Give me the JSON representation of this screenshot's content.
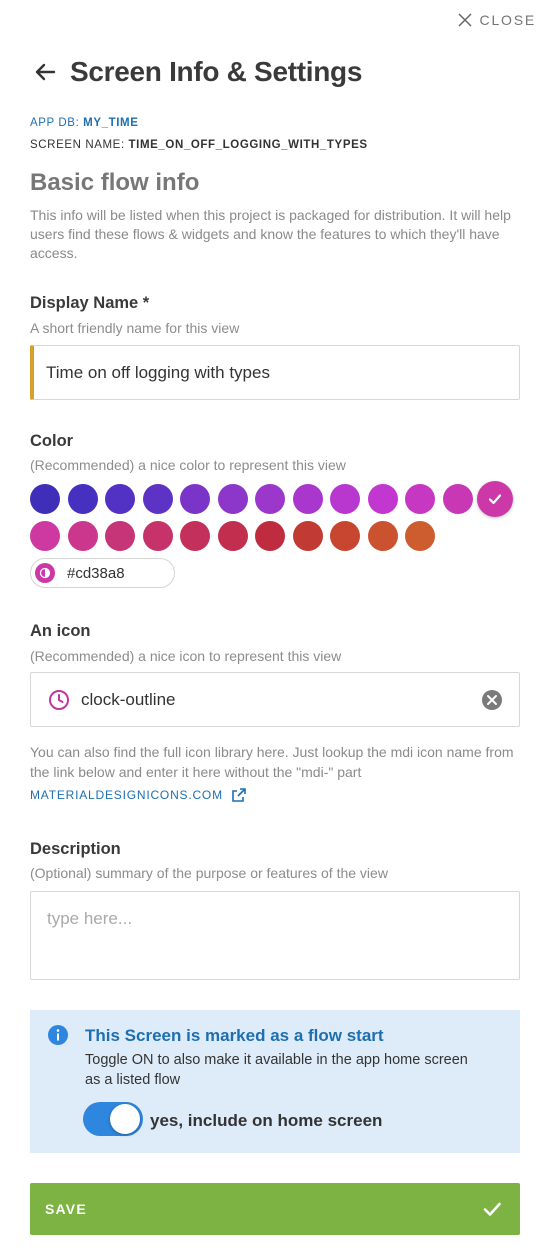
{
  "close": {
    "label": "CLOSE",
    "icon": "close-icon"
  },
  "header": {
    "title": "Screen Info & Settings",
    "back_icon": "arrow-left-icon"
  },
  "meta": {
    "app_db_key": "APP DB:",
    "app_db_value": "MY_TIME",
    "screen_name_key": "SCREEN NAME:",
    "screen_name_value": "TIME_ON_OFF_LOGGING_WITH_TYPES"
  },
  "section": {
    "title": "Basic flow info",
    "description": "This info will be listed when this project is packaged for distribution. It will help users find these flows & widgets and know the features to which they'll have access."
  },
  "display_name": {
    "label": "Display Name *",
    "hint": "A short friendly name for this view",
    "value": "Time on off logging with types"
  },
  "color": {
    "label": "Color",
    "hint": "(Recommended) a nice color to represent this view",
    "swatches": [
      "#3f2fb8",
      "#4630c0",
      "#5232c4",
      "#5d33c6",
      "#7a35c8",
      "#8c36ca",
      "#9c37cc",
      "#a937ce",
      "#b737cf",
      "#c237cf",
      "#c638c2",
      "#c938b4",
      "#cd38a8",
      "#cd39a0",
      "#ca378d",
      "#c73579",
      "#c5336a",
      "#c3305b",
      "#c12e4e",
      "#bf2b3f",
      "#c23a34",
      "#c84530",
      "#cb522e",
      "#cd5d2e"
    ],
    "selected": "#cd38a8",
    "hex_value": "#cd38a8"
  },
  "icon_field": {
    "label": "An icon",
    "hint": "(Recommended) a nice icon to represent this view",
    "value": "clock-outline",
    "icon": "clock-outline-icon",
    "icon_color": "#c2369e",
    "help_text": "You can also find the full icon library here. Just lookup the mdi icon name from the link below and enter it here without the \"mdi-\" part",
    "link_label": "MATERIALDESIGNICONS.COM"
  },
  "description": {
    "label": "Description",
    "hint": "(Optional) summary of the purpose or features of the view",
    "placeholder": "type here..."
  },
  "flow_start": {
    "title": "This Screen is marked as a flow start",
    "text": "Toggle ON to also make it available in the app home screen as a listed flow",
    "toggle_on": true,
    "toggle_label": "yes, include on home screen"
  },
  "save": {
    "label": "SAVE",
    "icon": "check-icon",
    "color": "#7cb342"
  }
}
